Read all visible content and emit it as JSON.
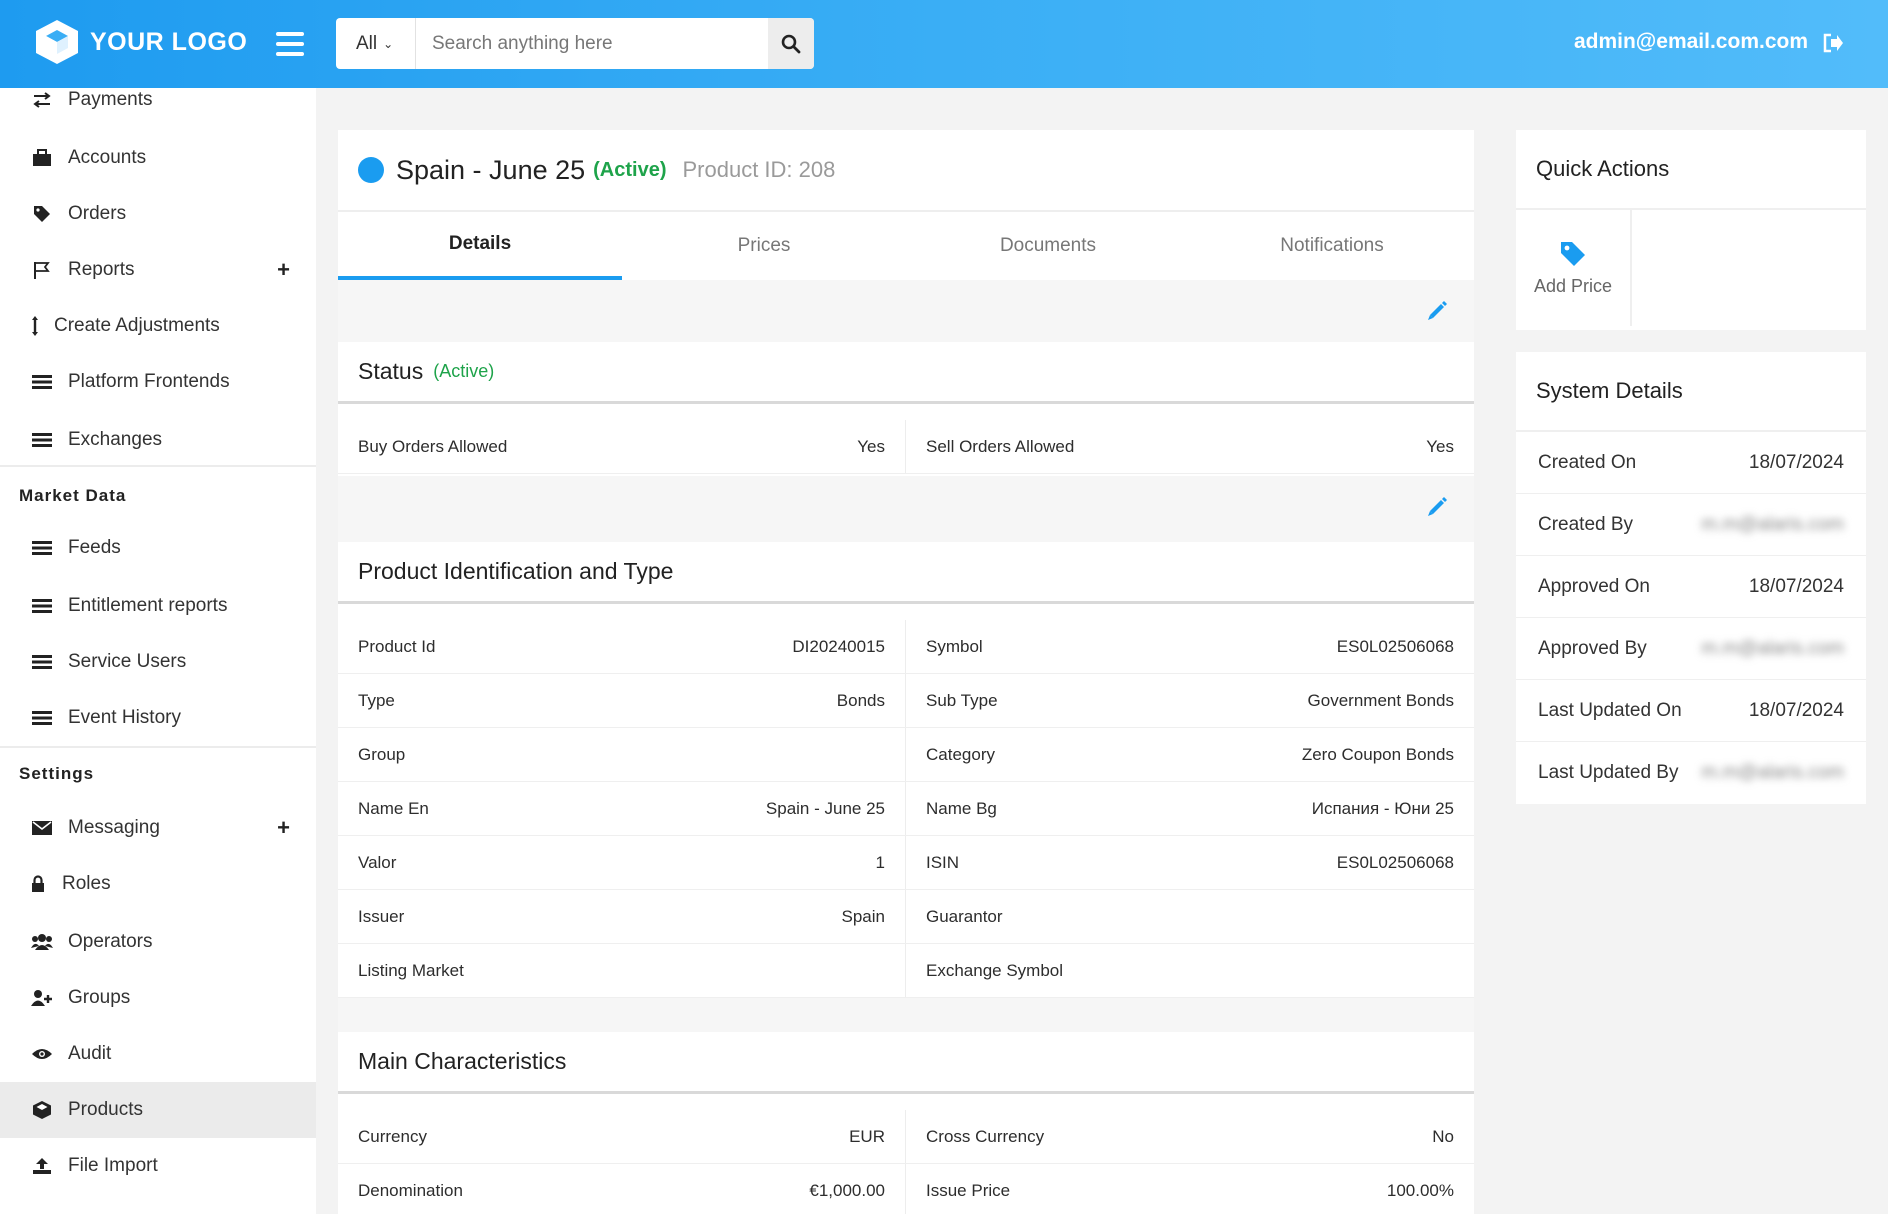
{
  "header": {
    "logo_text": "YOUR LOGO",
    "search_scope": "All",
    "search_placeholder": "Search anything here",
    "user_email": "admin@email.com.com"
  },
  "sidebar": {
    "items_top": [
      {
        "label": "Payments",
        "icon": "exchange-icon"
      },
      {
        "label": "Accounts",
        "icon": "briefcase-icon"
      },
      {
        "label": "Orders",
        "icon": "tag-icon"
      },
      {
        "label": "Reports",
        "icon": "flag-icon",
        "expandable": true
      },
      {
        "label": "Create Adjustments",
        "icon": "vertical-arrows-icon"
      },
      {
        "label": "Platform Frontends",
        "icon": "list-icon"
      },
      {
        "label": "Exchanges",
        "icon": "list-icon"
      }
    ],
    "market_data_title": "Market Data",
    "items_market": [
      {
        "label": "Feeds",
        "icon": "list-icon"
      },
      {
        "label": "Entitlement reports",
        "icon": "list-icon"
      },
      {
        "label": "Service Users",
        "icon": "list-icon"
      },
      {
        "label": "Event History",
        "icon": "list-icon"
      }
    ],
    "settings_title": "Settings",
    "items_settings": [
      {
        "label": "Messaging",
        "icon": "envelope-icon",
        "expandable": true
      },
      {
        "label": "Roles",
        "icon": "lock-icon"
      },
      {
        "label": "Operators",
        "icon": "users-icon"
      },
      {
        "label": "Groups",
        "icon": "user-plus-icon"
      },
      {
        "label": "Audit",
        "icon": "eye-icon"
      },
      {
        "label": "Products",
        "icon": "cube-icon",
        "active": true
      },
      {
        "label": "File Import",
        "icon": "upload-icon"
      }
    ],
    "plus": "+"
  },
  "product": {
    "name": "Spain - June 25",
    "status": "(Active)",
    "product_id_label": "Product ID: 208"
  },
  "tabs": [
    "Details",
    "Prices",
    "Documents",
    "Notifications"
  ],
  "status_section": {
    "title": "Status",
    "status": "(Active)",
    "rows": [
      [
        {
          "k": "Buy Orders Allowed",
          "v": "Yes"
        },
        {
          "k": "Sell Orders Allowed",
          "v": "Yes"
        }
      ]
    ]
  },
  "identification_section": {
    "title": "Product Identification and Type",
    "rows": [
      [
        {
          "k": "Product Id",
          "v": "DI20240015"
        },
        {
          "k": "Symbol",
          "v": "ES0L02506068"
        }
      ],
      [
        {
          "k": "Type",
          "v": "Bonds"
        },
        {
          "k": "Sub Type",
          "v": "Government Bonds"
        }
      ],
      [
        {
          "k": "Group",
          "v": ""
        },
        {
          "k": "Category",
          "v": "Zero Coupon Bonds"
        }
      ],
      [
        {
          "k": "Name En",
          "v": "Spain - June 25"
        },
        {
          "k": "Name Bg",
          "v": "Испания - Юни 25"
        }
      ],
      [
        {
          "k": "Valor",
          "v": "1"
        },
        {
          "k": "ISIN",
          "v": "ES0L02506068"
        }
      ],
      [
        {
          "k": "Issuer",
          "v": "Spain"
        },
        {
          "k": "Guarantor",
          "v": ""
        }
      ],
      [
        {
          "k": "Listing Market",
          "v": ""
        },
        {
          "k": "Exchange Symbol",
          "v": ""
        }
      ]
    ]
  },
  "characteristics_section": {
    "title": "Main Characteristics",
    "rows": [
      [
        {
          "k": "Currency",
          "v": "EUR"
        },
        {
          "k": "Cross Currency",
          "v": "No"
        }
      ],
      [
        {
          "k": "Denomination",
          "v": "€1,000.00"
        },
        {
          "k": "Issue Price",
          "v": "100.00%"
        }
      ]
    ]
  },
  "quick_actions": {
    "title": "Quick Actions",
    "add_price_label": "Add Price"
  },
  "system_details": {
    "title": "System Details",
    "rows": [
      {
        "k": "Created On",
        "v": "18/07/2024"
      },
      {
        "k": "Created By",
        "v": "m.m@alaris.com",
        "blurred": true
      },
      {
        "k": "Approved On",
        "v": "18/07/2024"
      },
      {
        "k": "Approved By",
        "v": "m.m@alaris.com",
        "blurred": true
      },
      {
        "k": "Last Updated On",
        "v": "18/07/2024"
      },
      {
        "k": "Last Updated By",
        "v": "m.m@alaris.com",
        "blurred": true
      }
    ]
  },
  "colors": {
    "header_start": "#1e9bf0",
    "header_end": "#52bcfa",
    "accent": "#1a9cf0",
    "status_green": "#1ea34a"
  }
}
